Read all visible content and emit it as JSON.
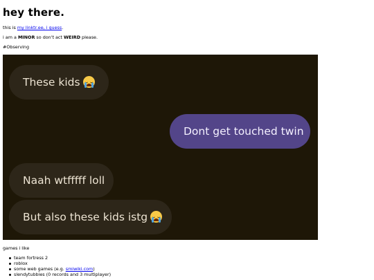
{
  "page": {
    "title": "hey there.",
    "intro_prefix": "this is ",
    "intro_link": "my linktr.ee, i guess",
    "intro_suffix": ".",
    "minor_prefix": "i am a ",
    "minor_bold": "MINOR",
    "minor_middle": " so don't act ",
    "minor_bold2": "WEIRD",
    "minor_suffix": " please.",
    "hashtag": "#Observing"
  },
  "chat": {
    "messages": [
      {
        "from": "them",
        "text": "These kids",
        "emoji": "loudly-crying-face"
      },
      {
        "from": "me",
        "text": "Dont get touched twin"
      },
      {
        "from": "them",
        "text": "Naah wtfffff loll"
      },
      {
        "from": "them",
        "text": "But also these kids istg",
        "emoji": "loudly-crying-face"
      }
    ],
    "colors": {
      "background": "#1e1707",
      "incoming_bubble": "#2d2619",
      "outgoing_bubble": "#534589"
    }
  },
  "games": {
    "title": "games i like",
    "items": [
      {
        "text": "team fortress 2"
      },
      {
        "text": "roblox"
      },
      {
        "text_prefix": "some web games (e.g. ",
        "link": "smiwiki.com",
        "text_suffix": ")"
      },
      {
        "text": "slendytubbies (0 records and 3 multiplayer)"
      }
    ]
  },
  "colors": {
    "link": "#0000ee",
    "text": "#000000"
  }
}
